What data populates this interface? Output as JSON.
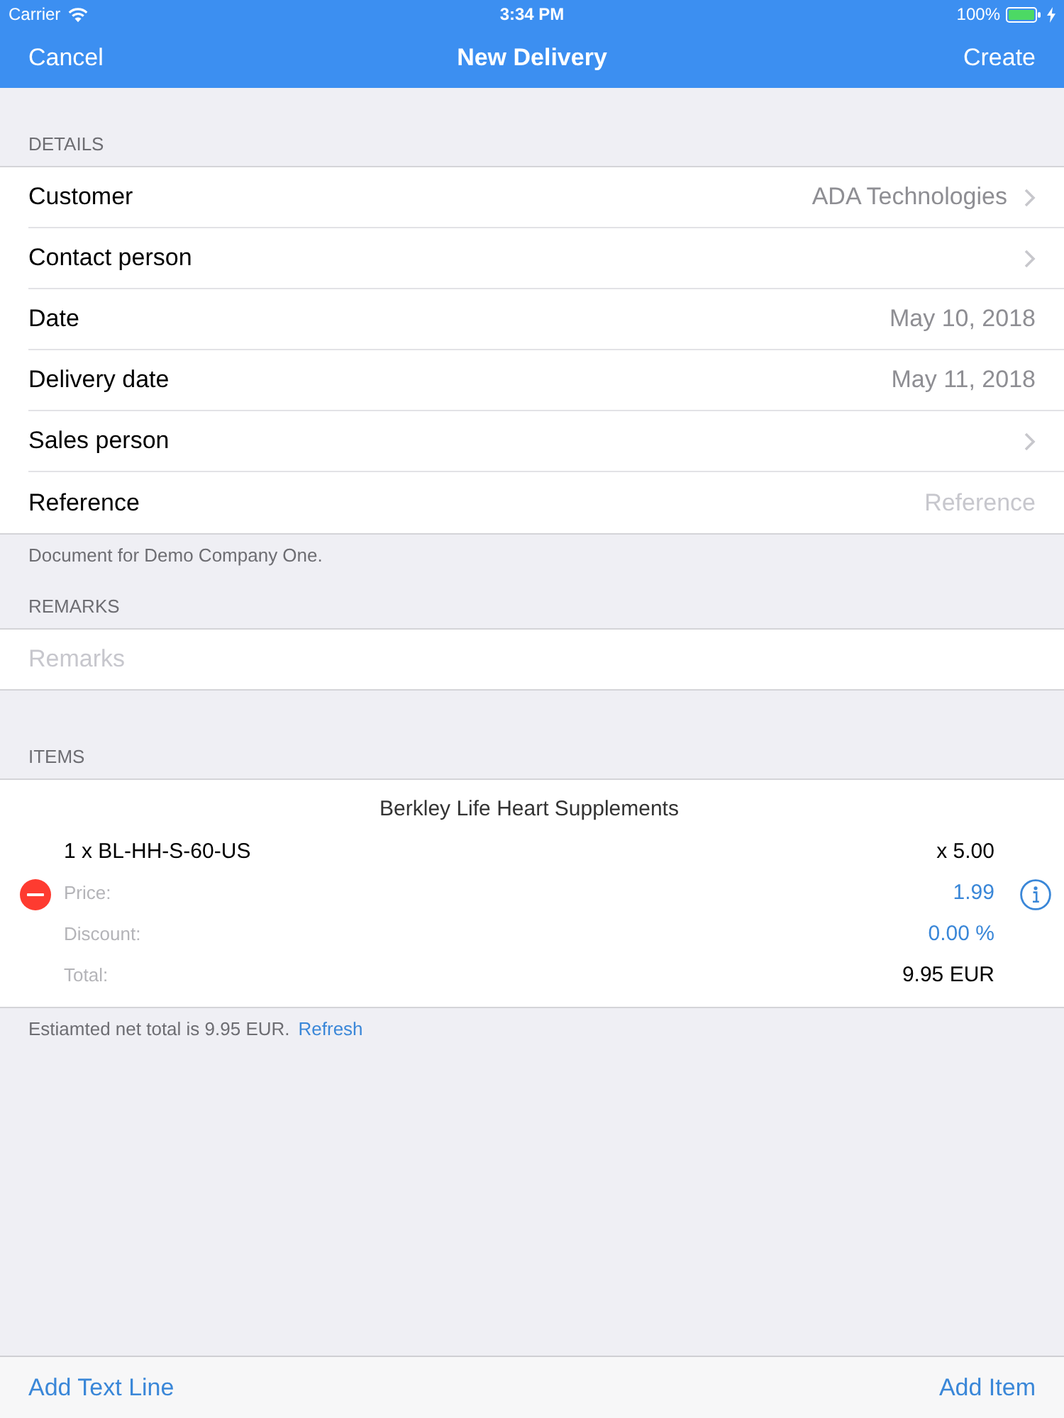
{
  "status_bar": {
    "carrier": "Carrier",
    "time": "3:34 PM",
    "battery": "100%"
  },
  "nav_bar": {
    "cancel": "Cancel",
    "title": "New Delivery",
    "create": "Create"
  },
  "details": {
    "header": "DETAILS",
    "rows": [
      {
        "kind": "disclosure",
        "label": "Customer",
        "value": "ADA Technologies"
      },
      {
        "kind": "disclosure",
        "label": "Contact person"
      },
      {
        "kind": "value",
        "label": "Date",
        "value": "May 10, 2018"
      },
      {
        "kind": "value",
        "label": "Delivery date",
        "value": "May 11, 2018"
      },
      {
        "kind": "disclosure",
        "label": "Sales person"
      },
      {
        "kind": "input",
        "label": "Reference",
        "placeholder": "Reference"
      }
    ],
    "footer": "Document for Demo Company One."
  },
  "remarks": {
    "header": "REMARKS",
    "placeholder": "Remarks"
  },
  "items": {
    "header": "ITEMS",
    "lines": [
      {
        "name": "Berkley Life Heart Supplements",
        "code": "1 x BL-HH-S-60-US",
        "quantity": "x 5.00",
        "price_label": "Price:",
        "price": "1.99",
        "discount_label": "Discount:",
        "discount": "0.00 %",
        "total_label": "Total:",
        "total": "9.95 EUR"
      }
    ],
    "footer": "Estiamted net total is 9.95 EUR.",
    "footer_link": "Refresh"
  },
  "toolbar": {
    "left": "Add Text Line",
    "right": "Add Item"
  }
}
